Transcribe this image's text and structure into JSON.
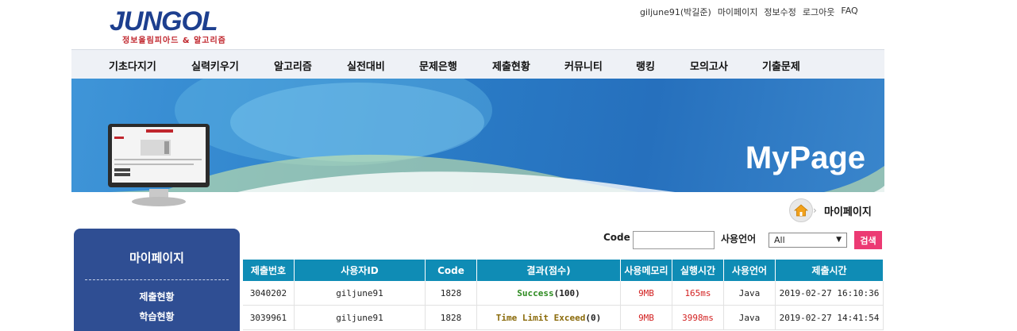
{
  "logo": {
    "main": "JUNGOL",
    "sub": "정보올림피아드 & 알고리즘"
  },
  "topnav": [
    "giljune91(박길준)",
    "마이페이지",
    "정보수정",
    "로그아웃",
    "FAQ"
  ],
  "menu": [
    "기초다지기",
    "실력키우기",
    "알고리즘",
    "실전대비",
    "문제은행",
    "제출현황",
    "커뮤니티",
    "랭킹",
    "모의고사",
    "기출문제"
  ],
  "banner": {
    "title": "MyPage"
  },
  "breadcrumb": {
    "label": "마이페이지"
  },
  "sidebar": {
    "title": "마이페이지",
    "items": [
      "제출현황",
      "학습현황"
    ]
  },
  "search": {
    "code_label": "Code",
    "code_value": "",
    "lang_label": "사용언어",
    "lang_value": "All",
    "button": "검색"
  },
  "table": {
    "headers": [
      "제출번호",
      "사용자ID",
      "Code",
      "결과(점수)",
      "사용메모리",
      "실행시간",
      "사용언어",
      "제출시간"
    ],
    "rows": [
      {
        "id": "3040202",
        "user": "giljune91",
        "code": "1828",
        "result": "Success",
        "score": "(100)",
        "memory": "9MB",
        "time": "165ms",
        "lang": "Java",
        "submitted": "2019-02-27 16:10:36",
        "result_color": "#2c8a1f"
      },
      {
        "id": "3039961",
        "user": "giljune91",
        "code": "1828",
        "result": "Time Limit Exceed",
        "score": "(0)",
        "memory": "9MB",
        "time": "3998ms",
        "lang": "Java",
        "submitted": "2019-02-27 14:41:54",
        "result_color": "#8a6a0a"
      }
    ]
  },
  "colors": {
    "header_bg": "#0f8cb5",
    "sidebar_bg": "#2f4e93",
    "search_button": "#ec3a73"
  }
}
